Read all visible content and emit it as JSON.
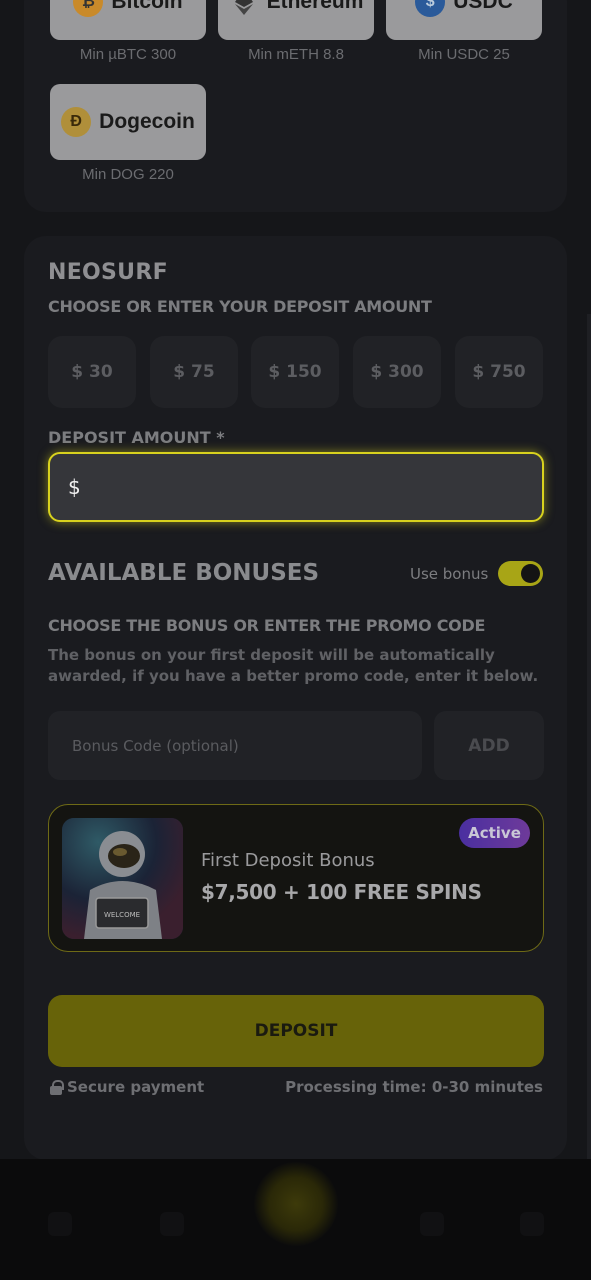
{
  "crypto": {
    "coins": [
      {
        "name": "Bitcoin",
        "icon": "bitcoin-icon",
        "min": "Min µBTC 300"
      },
      {
        "name": "Ethereum",
        "icon": "ethereum-icon",
        "min": "Min mETH 8.8"
      },
      {
        "name": "USDC",
        "icon": "usdc-icon",
        "min": "Min USDC 25"
      },
      {
        "name": "Dogecoin",
        "icon": "dogecoin-icon",
        "min": "Min DOG 220"
      }
    ]
  },
  "deposit": {
    "method": "NEOSURF",
    "choose_label": "CHOOSE OR ENTER YOUR DEPOSIT AMOUNT",
    "amounts": [
      "$ 30",
      "$ 75",
      "$ 150",
      "$ 300",
      "$ 750"
    ],
    "amount_label": "DEPOSIT AMOUNT *",
    "amount_prefix": "$",
    "amount_value": ""
  },
  "bonuses": {
    "title": "AVAILABLE BONUSES",
    "use_bonus_label": "Use bonus",
    "use_bonus_on": true,
    "choose_label": "CHOOSE THE BONUS OR ENTER THE PROMO CODE",
    "description": "The bonus on your first deposit will be automatically awarded, if you have a better promo code, enter it below.",
    "code_placeholder": "Bonus Code (optional)",
    "add_label": "ADD",
    "card": {
      "badge": "Active",
      "name": "First Deposit Bonus",
      "amount": "$7,500 + 100 FREE SPINS",
      "image_sign_text": "WELCOME"
    }
  },
  "footer": {
    "deposit_label": "DEPOSIT",
    "secure_label": "Secure payment",
    "processing_label": "Processing time: 0-30 minutes"
  },
  "colors": {
    "accent": "#d8d21e",
    "background": "#151619",
    "card": "#1a1b1f",
    "badge": "#5a33a0"
  }
}
